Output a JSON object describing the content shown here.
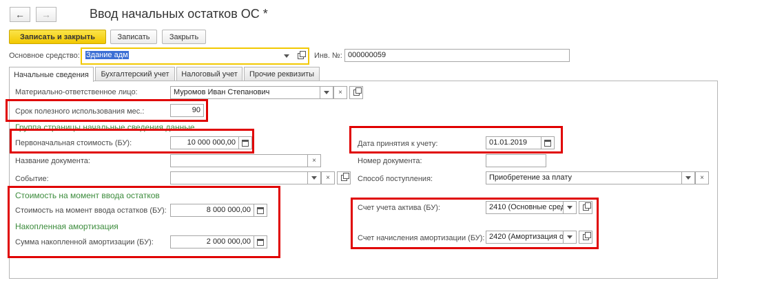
{
  "window": {
    "title": "Ввод начальных остатков ОС *"
  },
  "nav": {
    "back": "←",
    "forward": "→"
  },
  "toolbar": {
    "save_close_label": "Записать и закрыть",
    "save_label": "Записать",
    "close_label": "Закрыть"
  },
  "header": {
    "asset_label": "Основное средство:",
    "asset_value": "Здание адм",
    "inv_label": "Инв. №:",
    "inv_value": "000000059"
  },
  "tabs": [
    {
      "label": "Начальные сведения",
      "active": true
    },
    {
      "label": "Бухгалтерский учет",
      "active": false
    },
    {
      "label": "Налоговый учет",
      "active": false
    },
    {
      "label": "Прочие реквизиты",
      "active": false
    }
  ],
  "form": {
    "mol_label": "Материально-ответственное лицо:",
    "mol_value": "Муромов Иван Степанович",
    "useful_life_label": "Срок полезного использования мес.:",
    "useful_life_value": "90",
    "group_title": "Группа страницы начальные сведения данные",
    "initial_cost_label": "Первоначальная стоимость (БУ):",
    "initial_cost_value": "10 000 000,00",
    "acceptance_date_label": "Дата принятия к учету:",
    "acceptance_date_value": "01.01.2019",
    "doc_name_label": "Название документа:",
    "doc_name_value": "",
    "doc_number_label": "Номер документа:",
    "doc_number_value": "",
    "event_label": "Событие:",
    "event_value": "",
    "receipt_method_label": "Способ поступления:",
    "receipt_method_value": "Приобретение за плату",
    "cost_group_title": "Стоимость на момент ввода остатков",
    "cost_at_entry_label": "Стоимость на момент ввода остатков (БУ):",
    "cost_at_entry_value": "8 000 000,00",
    "amort_group_title": "Накопленная амортизация",
    "amort_sum_label": "Сумма накопленной амортизации (БУ):",
    "amort_sum_value": "2 000 000,00",
    "asset_account_label": "Счет учета актива (БУ):",
    "asset_account_value": "2410 (Основные сред",
    "amort_account_label": "Счет начисления амортизации (БУ):",
    "amort_account_value": "2420 (Амортизация о"
  },
  "colors": {
    "accent": "#f2c800",
    "highlight": "#e00000",
    "group": "#3b8b3b"
  }
}
